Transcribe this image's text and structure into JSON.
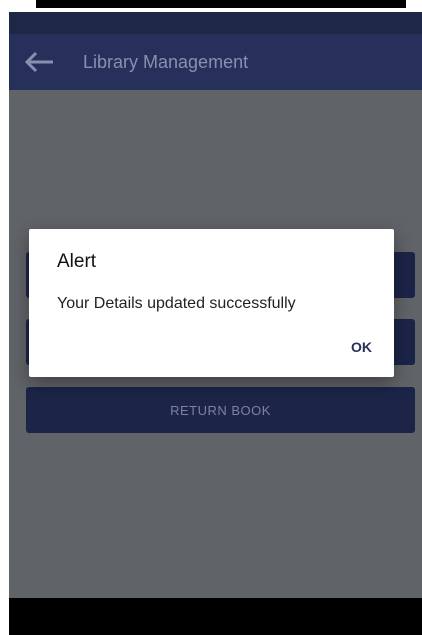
{
  "app_bar": {
    "title": "Library Management",
    "back_icon": "arrow-left-icon"
  },
  "menu": {
    "buttons": [
      {
        "label": ""
      },
      {
        "label": ""
      },
      {
        "label": "RETURN BOOK"
      }
    ]
  },
  "dialog": {
    "title": "Alert",
    "message": "Your Details updated successfully",
    "ok_label": "OK"
  },
  "colors": {
    "app_bar": "#26305a",
    "status_bar": "#1f2747",
    "scrim": "#5f6368",
    "button": "#1c2448",
    "dialog_ok": "#26305a"
  }
}
